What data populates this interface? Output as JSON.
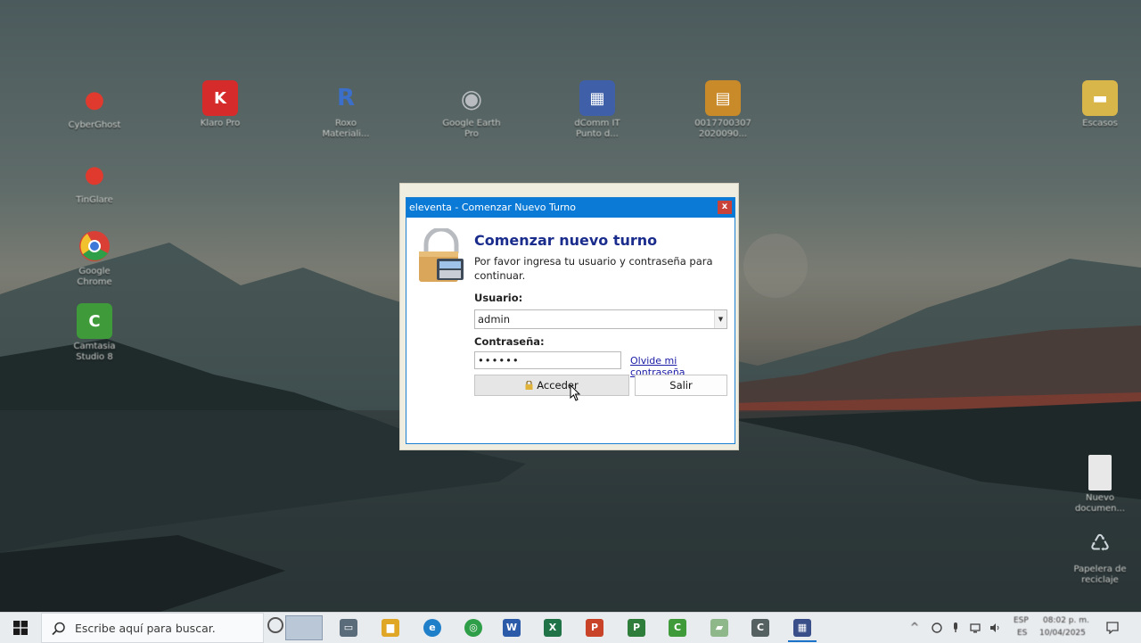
{
  "desktop": {
    "icons": [
      {
        "label": "CyberGhost",
        "color": "#e03a2f",
        "glyph": "●"
      },
      {
        "label": "Klaro Pro",
        "color": "#d62b2b",
        "glyph": "K"
      },
      {
        "label": "Roxo Materiali...",
        "color": "#3b6fc9",
        "glyph": "R"
      },
      {
        "label": "Google Earth Pro",
        "color": "#8a8f96",
        "glyph": "◉"
      },
      {
        "label": "dComm IT Punto d...",
        "color": "#3f5fa8",
        "glyph": "▦"
      },
      {
        "label": "0017700307 2020090...",
        "color": "#c98a2a",
        "glyph": "▤"
      },
      {
        "label": "Escasos",
        "color": "#d9b64a",
        "glyph": "▬"
      },
      {
        "label": "TinGlare",
        "color": "#e03a2f",
        "glyph": "●"
      },
      {
        "label": "Google Chrome",
        "color": "#2f9e48",
        "glyph": "◎"
      },
      {
        "label": "Camtasia Studio 8",
        "color": "#3f9b3a",
        "glyph": "C"
      },
      {
        "label": "Nuevo documen...",
        "color": "#e8e8e8",
        "glyph": "▯"
      },
      {
        "label": "Papelera de reciclaje",
        "color": "#cfd7dd",
        "glyph": "♺"
      }
    ]
  },
  "dialog": {
    "title": "eleventa - Comenzar Nuevo Turno",
    "close_label": "x",
    "heading": "Comenzar nuevo turno",
    "subtext": "Por favor ingresa tu usuario y contraseña para continuar.",
    "usuario_label": "Usuario:",
    "usuario_value": "admin",
    "contrasena_label": "Contraseña:",
    "contrasena_value": "••••••",
    "forgot_link": "Olvide mi contraseña",
    "access_button": "Acceder",
    "exit_button": "Salir"
  },
  "taskbar": {
    "search_placeholder": "Escribe aquí para buscar.",
    "apps": [
      {
        "name": "task-view",
        "color": "#5a6b7a",
        "glyph": "▭"
      },
      {
        "name": "file-explorer",
        "color": "#e0a626",
        "glyph": "▆"
      },
      {
        "name": "edge",
        "color": "#1f7fc9",
        "glyph": "e"
      },
      {
        "name": "chrome",
        "color": "#2f9e48",
        "glyph": "◎"
      },
      {
        "name": "word",
        "color": "#2b5aa8",
        "glyph": "W"
      },
      {
        "name": "excel",
        "color": "#207346",
        "glyph": "X"
      },
      {
        "name": "powerpoint",
        "color": "#c84328",
        "glyph": "P"
      },
      {
        "name": "project",
        "color": "#2f7d3a",
        "glyph": "P"
      },
      {
        "name": "camtasia",
        "color": "#3f9b3a",
        "glyph": "C"
      },
      {
        "name": "recorder",
        "color": "#8fb88a",
        "glyph": "▰"
      },
      {
        "name": "camtasia-studio",
        "color": "#556060",
        "glyph": "C"
      },
      {
        "name": "eleventa",
        "color": "#3a4f8a",
        "glyph": "▦"
      }
    ],
    "lang_top": "ESP",
    "lang_bottom": "ES",
    "time": "08:02 p. m.",
    "date": "10/04/2025"
  }
}
